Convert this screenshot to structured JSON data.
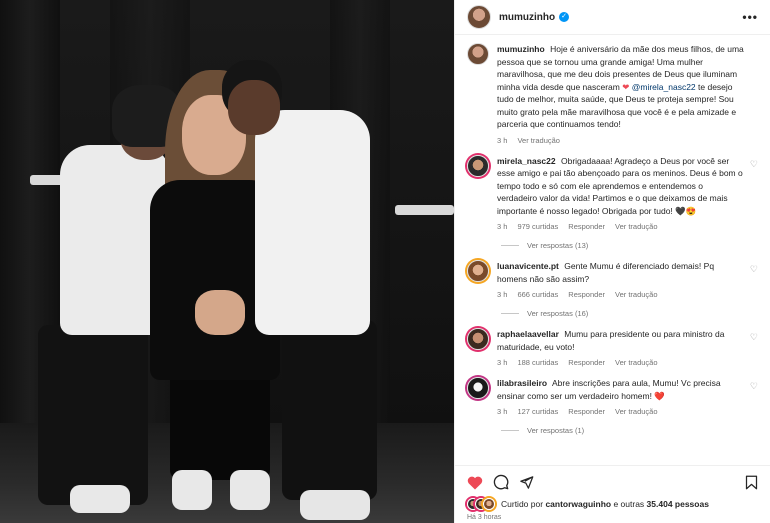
{
  "post": {
    "username": "mumuzinho",
    "more_label": "•••"
  },
  "caption": {
    "username": "mumuzinho",
    "text_part1": "Hoje é aniversário da mãe dos meus filhos, de uma pessoa que se tornou uma grande amiga! Uma mulher maravilhosa, que me deu dois presentes de Deus que iluminam minha vida desde que nasceram",
    "mention": "@mirela_nasc22",
    "text_part2": "te desejo tudo de melhor, muita saúde, que Deus te proteja sempre! Sou muito grato pela mãe maravilhosa que você é e pela amizade e parceria que continuamos tendo!",
    "time": "3 h",
    "translate": "Ver tradução"
  },
  "comments": [
    {
      "username": "mirela_nasc22",
      "text": "Obrigadaaaa! Agradeço a Deus por você ser esse amigo e pai tão abençoado para os meninos. Deus é bom o tempo todo e só com ele aprendemos e entendemos o verdadeiro valor da vida! Partimos e o que deixamos de mais importante é nosso legado! Obrigada por tudo! 🖤😍",
      "time": "3 h",
      "likes": "979 curtidas",
      "reply": "Responder",
      "translate": "Ver tradução",
      "view_replies": "Ver respostas (13)"
    },
    {
      "username": "luanavicente.pt",
      "text": "Gente Mumu é diferenciado demais! Pq homens não são assim?",
      "time": "3 h",
      "likes": "666 curtidas",
      "reply": "Responder",
      "translate": "Ver tradução",
      "view_replies": "Ver respostas (16)"
    },
    {
      "username": "raphaelaavellar",
      "text": "Mumu para presidente ou para ministro da maturidade, eu voto!",
      "time": "3 h",
      "likes": "188 curtidas",
      "reply": "Responder",
      "translate": "Ver tradução",
      "view_replies": ""
    },
    {
      "username": "lilabrasileiro",
      "text": "Abre inscrições para aula, Mumu! Vc precisa ensinar como ser um verdadeiro homem! ❤️",
      "time": "3 h",
      "likes": "127 curtidas",
      "reply": "Responder",
      "translate": "Ver tradução",
      "view_replies": "Ver respostas (1)"
    }
  ],
  "footer": {
    "liked_prefix": "Curtido por",
    "liked_user": "cantorwaguinho",
    "liked_middle": "e outras",
    "liked_count": "35.404 pessoas",
    "posted_time": "Há 3 horas"
  },
  "colors": {
    "like_red": "#ed4956",
    "verified_blue": "#0095f6"
  }
}
